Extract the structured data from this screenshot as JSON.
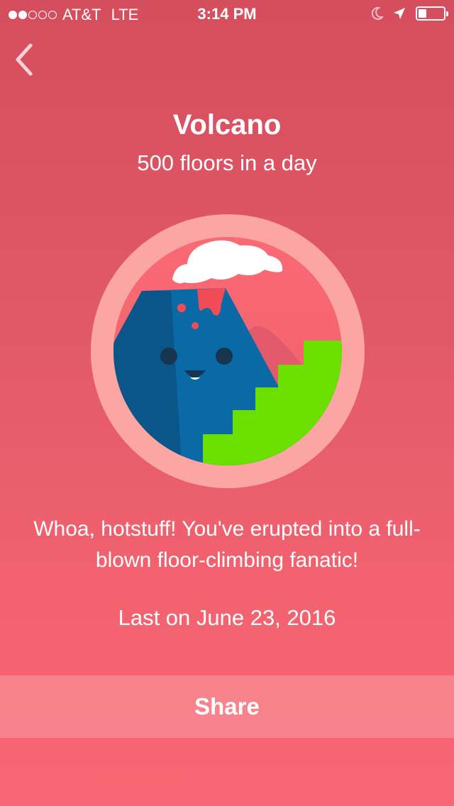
{
  "status_bar": {
    "carrier": "AT&T",
    "network": "LTE",
    "time": "3:14 PM",
    "signal_bars_filled": 2,
    "signal_bars_total": 5,
    "battery_level": 0.3,
    "icons": [
      "moon-icon",
      "location-arrow-icon",
      "battery-icon"
    ]
  },
  "nav": {
    "back_icon": "chevron-left-icon"
  },
  "badge": {
    "title": "Volcano",
    "subtitle": "500 floors in a day",
    "message": "Whoa, hotstuff! You've erupted into a full-blown floor-climbing fanatic!",
    "last_earned": "Last on June 23, 2016"
  },
  "actions": {
    "share_label": "Share"
  },
  "colors": {
    "background_top": "#d54e5d",
    "background_bottom": "#f86673",
    "badge_ring": "#fca6a3",
    "volcano_blue": "#0a6aa6",
    "stairs_green": "#6bdf00",
    "lava_red": "#f24d56"
  }
}
